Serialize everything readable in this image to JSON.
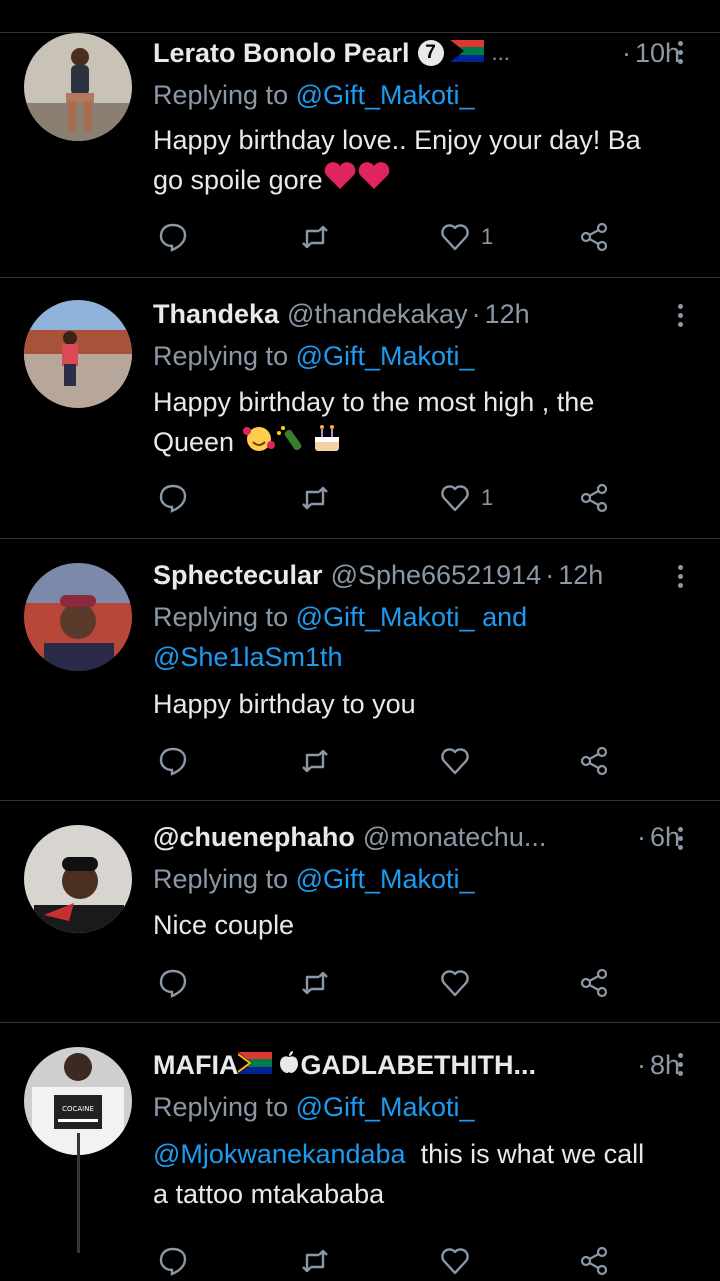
{
  "tweets": [
    {
      "display_name": "Lerato Bonolo Pearl",
      "badge": "7",
      "name_suffix": "...",
      "handle": "",
      "time": "10h",
      "reply_prefix": "Replying to ",
      "reply_to": "@Gift_Makoti_",
      "text_line1": "Happy birthday love.. Enjoy your day! Ba",
      "text_line2": "go spoile gore",
      "likes": "1"
    },
    {
      "display_name": "Thandeka",
      "handle": "@thandekakay",
      "time": "12h",
      "reply_prefix": "Replying to ",
      "reply_to": "@Gift_Makoti_",
      "text_line1": "Happy birthday to the most high , the",
      "text_line2": "Queen",
      "likes": "1"
    },
    {
      "display_name": "Sphectecular",
      "handle": "@Sphe66521914",
      "time": "12h",
      "reply_prefix": "Replying to ",
      "reply_to": "@Gift_Makoti_",
      "reply_and": " and",
      "reply_to_2": "@She1laSm1th",
      "text_line1": "Happy birthday to you"
    },
    {
      "display_name": "@chuenephaho",
      "handle": "@monatechu...",
      "time": "6h",
      "reply_prefix": "Replying to ",
      "reply_to": "@Gift_Makoti_",
      "text_line1": "Nice couple"
    },
    {
      "display_name": "MAFIA",
      "display_name_2": "GADLABETHITH...",
      "time": "8h",
      "reply_prefix": "Replying to ",
      "reply_to": "@Gift_Makoti_",
      "text_mention": "@Mjokwanekandaba",
      "text_line1": "  this is what we call",
      "text_line2": "a tattoo mtakababa",
      "shirt_text": "COCAINE"
    }
  ],
  "separator": "·",
  "colors": {
    "background": "#000000",
    "text": "#e7e9ea",
    "muted": "#8b98a5",
    "link": "#1d9bf0",
    "divider": "#2f3336",
    "heart": "#e0245e"
  },
  "icons": [
    "reply-icon",
    "retweet-icon",
    "like-icon",
    "share-icon",
    "more-icon",
    "south-africa-flag-icon",
    "apple-icon",
    "heart-emoji",
    "smiling-hearts-emoji",
    "champagne-emoji",
    "birthday-cake-emoji"
  ]
}
